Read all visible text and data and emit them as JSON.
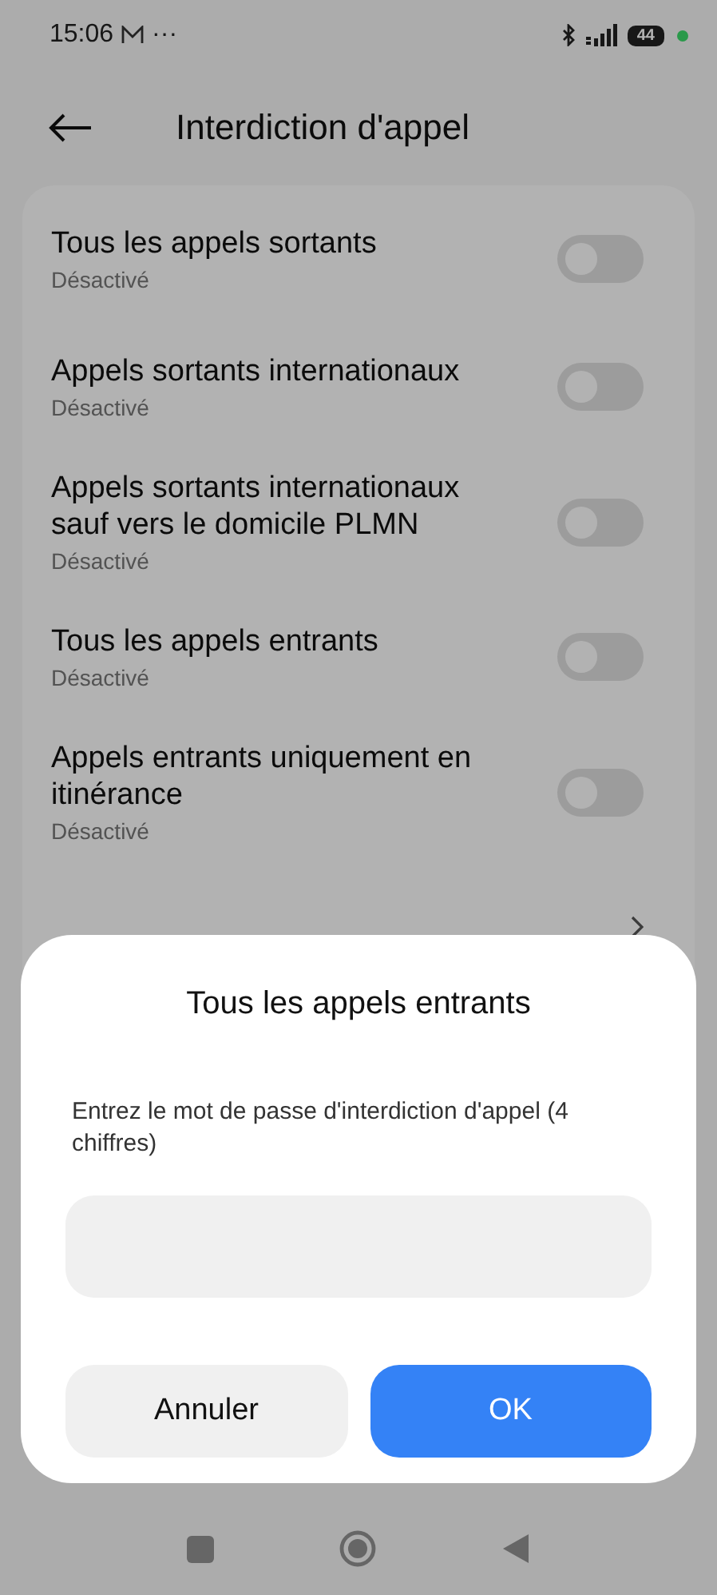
{
  "status_bar": {
    "time": "15:06",
    "more": "···",
    "battery": "44"
  },
  "header": {
    "title": "Interdiction d'appel"
  },
  "items": [
    {
      "title": "Tous les appels sortants",
      "subtitle": "Désactivé",
      "kind": "toggle",
      "on": false
    },
    {
      "title": "Appels sortants internationaux",
      "subtitle": "Désactivé",
      "kind": "toggle",
      "on": false
    },
    {
      "title": "Appels sortants internationaux sauf vers le domicile PLMN",
      "subtitle": "Désactivé",
      "kind": "toggle",
      "on": false
    },
    {
      "title": "Tous les appels entrants",
      "subtitle": "Désactivé",
      "kind": "toggle",
      "on": false
    },
    {
      "title": "Appels entrants uniquement en itinérance",
      "subtitle": "Désactivé",
      "kind": "toggle",
      "on": false
    },
    {
      "kind": "link"
    }
  ],
  "dialog": {
    "title": "Tous les appels entrants",
    "label": "Entrez le mot de passe d'interdiction d'appel (4 chiffres)",
    "buttons": [
      {
        "label": "Annuler",
        "kind": "secondary"
      },
      {
        "label": "OK",
        "kind": "primary"
      }
    ]
  }
}
